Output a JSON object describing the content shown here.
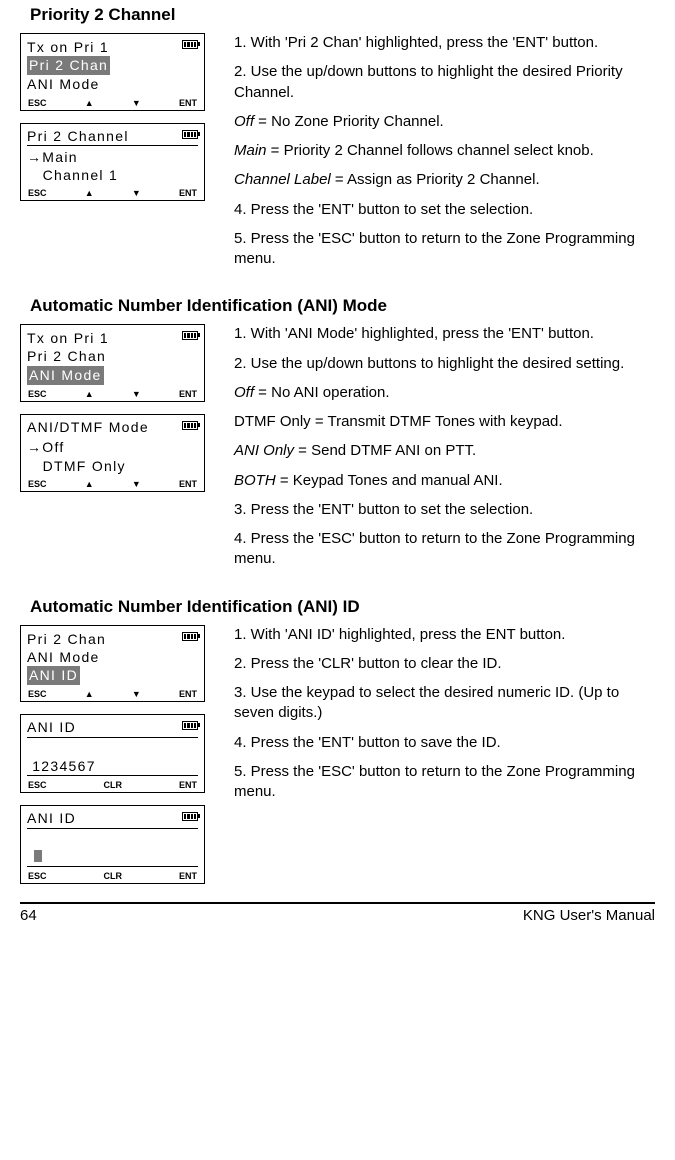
{
  "sec1": {
    "heading": "Priority 2 Channel",
    "lcd1": {
      "line1": "Tx on Pri 1",
      "line2": "Pri 2 Chan",
      "line3": "ANI Mode",
      "sk1": "ESC",
      "sk2": "▲",
      "sk3": "▼",
      "sk4": "ENT"
    },
    "lcd2": {
      "line1": "Pri 2 Channel",
      "line2": "→Main",
      "line3": "   Channel 1",
      "sk1": "ESC",
      "sk2": "▲",
      "sk3": "▼",
      "sk4": "ENT"
    },
    "p1": "1.   With 'Pri 2 Chan' highlighted, press the 'ENT' button.",
    "p2": "2.   Use the up/down buttons to highlight the desired Priority Channel.",
    "p3a": "Off",
    "p3b": " = No Zone Priority Channel.",
    "p4a": "Main",
    "p4b": " = Priority 2 Channel follows channel select knob.",
    "p5a": "Channel Label",
    "p5b": " = Assign as Priority 2 Channel.",
    "p6": "4.   Press the 'ENT' button to set the selection.",
    "p7": "5.   Press the 'ESC' button to return to the Zone Programming menu."
  },
  "sec2": {
    "heading": "Automatic Number Identification (ANI) Mode",
    "lcd1": {
      "line1": "Tx on Pri 1",
      "line2": "Pri 2 Chan",
      "line3": "ANI Mode",
      "sk1": "ESC",
      "sk2": "▲",
      "sk3": "▼",
      "sk4": "ENT"
    },
    "lcd2": {
      "line1": "ANI/DTMF Mode",
      "line2": "→Off",
      "line3": "   DTMF Only",
      "sk1": "ESC",
      "sk2": "▲",
      "sk3": "▼",
      "sk4": "ENT"
    },
    "p1": "1.   With 'ANI Mode' highlighted, press the 'ENT' button.",
    "p2": "2.   Use the up/down buttons to highlight the desired setting.",
    "p3a": "Off",
    "p3b": " = No ANI operation.",
    "p4": "DTMF Only = Transmit DTMF Tones with keypad.",
    "p5a": "ANI Only",
    "p5b": " = Send DTMF ANI on PTT.",
    "p6a": "BOTH",
    "p6b": " = Keypad Tones and manual ANI.",
    "p7": "3.   Press the 'ENT' button to set the selection.",
    "p8": "4.   Press the 'ESC' button to return to the Zone Programming menu."
  },
  "sec3": {
    "heading": "Automatic Number Identification (ANI) ID",
    "lcd1": {
      "line1": "Pri 2 Chan",
      "line2": "ANI Mode",
      "line3": "ANI ID",
      "sk1": "ESC",
      "sk2": "▲",
      "sk3": "▼",
      "sk4": "ENT"
    },
    "lcd2": {
      "line1": "ANI ID",
      "line3": " 1234567",
      "sk1": "ESC",
      "sk2": "CLR",
      "sk3": "ENT"
    },
    "lcd3": {
      "line1": "ANI ID",
      "sk1": "ESC",
      "sk2": "CLR",
      "sk3": "ENT"
    },
    "p1": "1.  With 'ANI ID' highlighted, press the ENT button.",
    "p2": "2.   Press the 'CLR' button to clear the ID.",
    "p3": "3.   Use the keypad to select the desired numeric ID. (Up to seven digits.)",
    "p4": "4.   Press the 'ENT' button to save the ID.",
    "p5": "5.   Press the 'ESC' button to return to the Zone Programming menu."
  },
  "footer": {
    "page": "64",
    "title": "KNG User's Manual"
  }
}
